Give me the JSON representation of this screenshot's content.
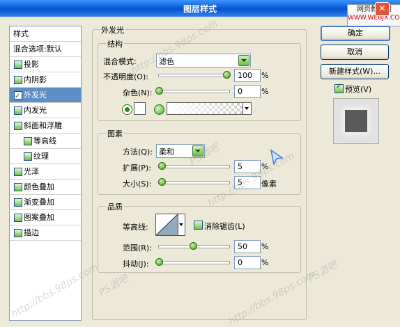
{
  "window": {
    "title": "图层样式",
    "close_icon": "close-icon"
  },
  "corner_watermark": {
    "line1": "网页教学网",
    "line2": "WWW.WEBJX.COM"
  },
  "style_list": {
    "header": "样式",
    "blend_options": "混合选项:默认",
    "items": [
      {
        "label": "投影",
        "checked": false
      },
      {
        "label": "内阴影",
        "checked": false
      },
      {
        "label": "外发光",
        "checked": true,
        "selected": true
      },
      {
        "label": "内发光",
        "checked": false
      },
      {
        "label": "斜面和浮雕",
        "checked": false
      },
      {
        "label": "等高线",
        "checked": false,
        "indent": true
      },
      {
        "label": "纹理",
        "checked": false,
        "indent": true
      },
      {
        "label": "光泽",
        "checked": false
      },
      {
        "label": "颜色叠加",
        "checked": false
      },
      {
        "label": "渐变叠加",
        "checked": false
      },
      {
        "label": "图案叠加",
        "checked": false
      },
      {
        "label": "描边",
        "checked": false
      }
    ]
  },
  "outer_glow": {
    "group_title": "外发光",
    "structure": {
      "title": "结构",
      "blend_mode_label": "混合模式:",
      "blend_mode_value": "滤色",
      "opacity_label": "不透明度(O):",
      "opacity_value": "100",
      "opacity_unit": "%",
      "noise_label": "杂色(N):",
      "noise_value": "0",
      "noise_unit": "%"
    },
    "elements": {
      "title": "图素",
      "method_label": "方法(Q):",
      "method_value": "柔和",
      "spread_label": "扩展(P):",
      "spread_value": "5",
      "spread_unit": "%",
      "size_label": "大小(S):",
      "size_value": "5",
      "size_unit": "像素"
    },
    "quality": {
      "title": "品质",
      "contour_label": "等高线:",
      "antialias_label": "消除锯齿(L)",
      "range_label": "范围(R):",
      "range_value": "50",
      "range_unit": "%",
      "jitter_label": "抖动(J):",
      "jitter_value": "0",
      "jitter_unit": "%"
    }
  },
  "buttons": {
    "ok": "确定",
    "cancel": "取消",
    "new_style": "新建样式(W)...",
    "preview": "预览(V)"
  },
  "watermarks": [
    "PS酒吧",
    "http://bbs.98ps.com"
  ]
}
